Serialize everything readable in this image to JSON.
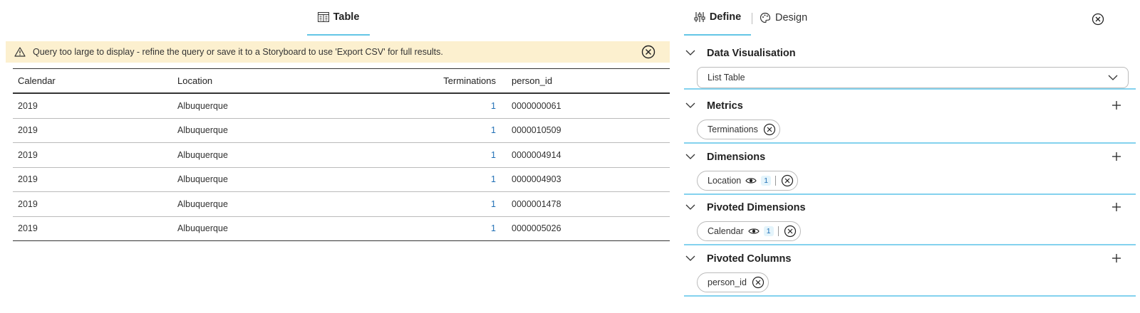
{
  "left": {
    "tab_label": "Table",
    "banner": "Query too large to display - refine the query or save it to a Storyboard to use 'Export CSV' for full results.",
    "columns": [
      "Calendar",
      "Location",
      "Terminations",
      "person_id"
    ],
    "rows": [
      [
        "2019",
        "Albuquerque",
        "1",
        "0000000061"
      ],
      [
        "2019",
        "Albuquerque",
        "1",
        "0000010509"
      ],
      [
        "2019",
        "Albuquerque",
        "1",
        "0000004914"
      ],
      [
        "2019",
        "Albuquerque",
        "1",
        "0000004903"
      ],
      [
        "2019",
        "Albuquerque",
        "1",
        "0000001478"
      ],
      [
        "2019",
        "Albuquerque",
        "1",
        "0000005026"
      ]
    ]
  },
  "right": {
    "tabs": {
      "define": "Define",
      "design": "Design"
    },
    "sections": {
      "data_vis": {
        "title": "Data Visualisation",
        "selected": "List Table"
      },
      "metrics": {
        "title": "Metrics",
        "chips": [
          {
            "label": "Terminations"
          }
        ]
      },
      "dimensions": {
        "title": "Dimensions",
        "chips": [
          {
            "label": "Location",
            "count": "1"
          }
        ]
      },
      "pivoted_dimensions": {
        "title": "Pivoted Dimensions",
        "chips": [
          {
            "label": "Calendar",
            "count": "1"
          }
        ]
      },
      "pivoted_columns": {
        "title": "Pivoted Columns",
        "chips": [
          {
            "label": "person_id"
          }
        ]
      }
    }
  },
  "icons": {
    "table_tab": "table-icon",
    "warning": "warning-triangle-icon",
    "close": "close-circle-icon",
    "define_tab": "sliders-icon",
    "design_tab": "palette-icon",
    "chevron": "chevron-down-icon",
    "add": "plus-icon",
    "visibility": "eye-icon"
  },
  "colors": {
    "accent": "#63c5e6",
    "banner_bg": "#fcf0cf",
    "link": "#1f6fb5"
  }
}
